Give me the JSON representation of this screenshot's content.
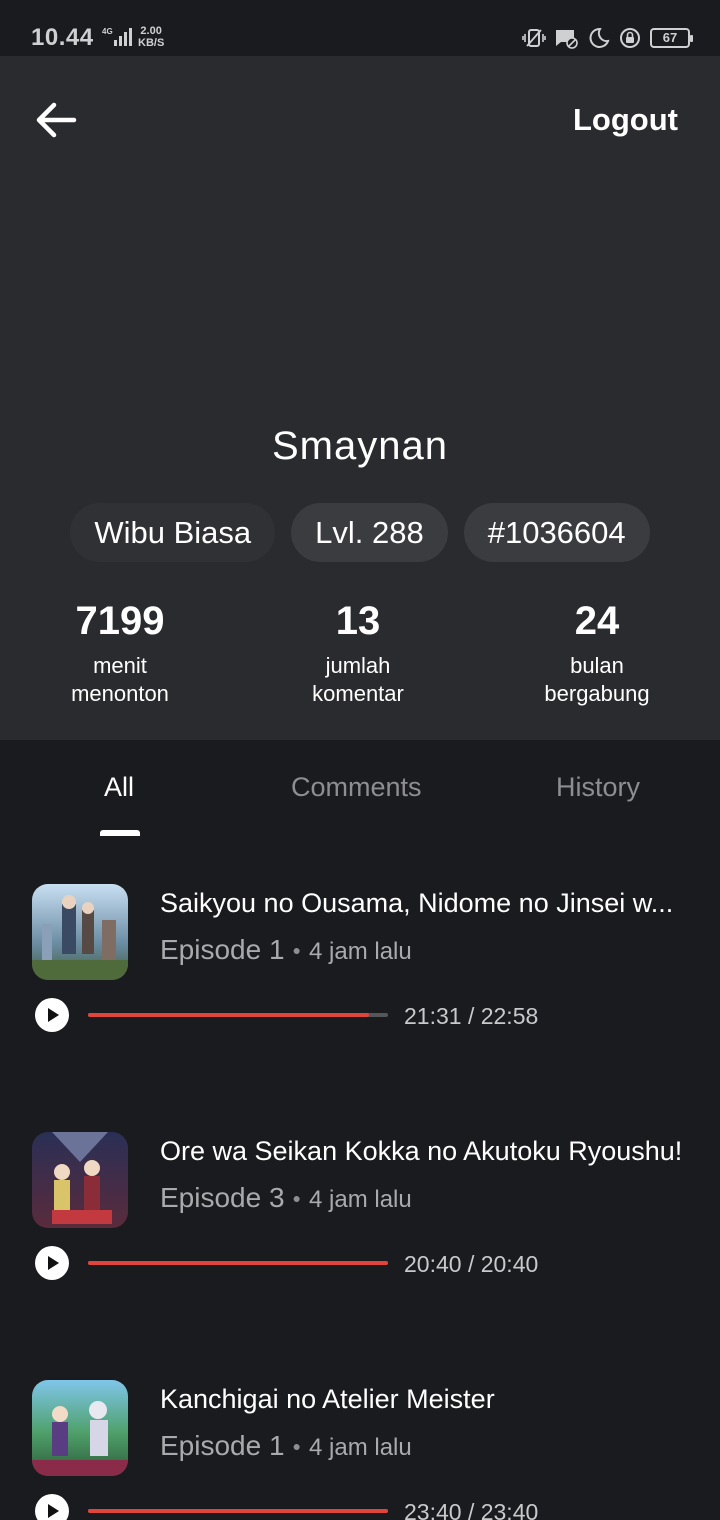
{
  "status_bar": {
    "time": "10.44",
    "net_type": "4G",
    "speed_value": "2.00",
    "speed_unit": "KB/S",
    "battery": "67",
    "icons": [
      "signal-icon",
      "vibrate-icon",
      "message-icon",
      "moon-icon",
      "lock-rotation-icon",
      "battery-icon"
    ]
  },
  "header": {
    "back_icon": "arrow-left-icon",
    "logout_label": "Logout"
  },
  "profile": {
    "username": "Smaynan",
    "badges": [
      "Wibu Biasa",
      "Lvl. 288",
      "#1036604"
    ],
    "stats": [
      {
        "value": "7199",
        "label_line1": "menit",
        "label_line2": "menonton"
      },
      {
        "value": "13",
        "label_line1": "jumlah",
        "label_line2": "komentar"
      },
      {
        "value": "24",
        "label_line1": "bulan",
        "label_line2": "bergabung"
      }
    ]
  },
  "tabs": [
    {
      "label": "All",
      "active": true
    },
    {
      "label": "Comments",
      "active": false
    },
    {
      "label": "History",
      "active": false
    }
  ],
  "items": [
    {
      "title": "Saikyou no Ousama, Nidome no Jinsei w...",
      "episode": "Episode 1",
      "ago": "4 jam lalu",
      "time": "21:31 / 22:58",
      "progress": 0.937
    },
    {
      "title": "Ore wa Seikan Kokka no Akutoku Ryoushu!",
      "episode": "Episode 3",
      "ago": "4 jam lalu",
      "time": "20:40 / 20:40",
      "progress": 1.0
    },
    {
      "title": "Kanchigai no Atelier Meister",
      "episode": "Episode 1",
      "ago": "4 jam lalu",
      "time": "23:40 / 23:40",
      "progress": 1.0
    }
  ],
  "colors": {
    "background": "#1a1b1e",
    "profile_bg": "#2a2b2e",
    "accent_progress": "#e0443a",
    "badge_bg": "#3b3c40"
  }
}
